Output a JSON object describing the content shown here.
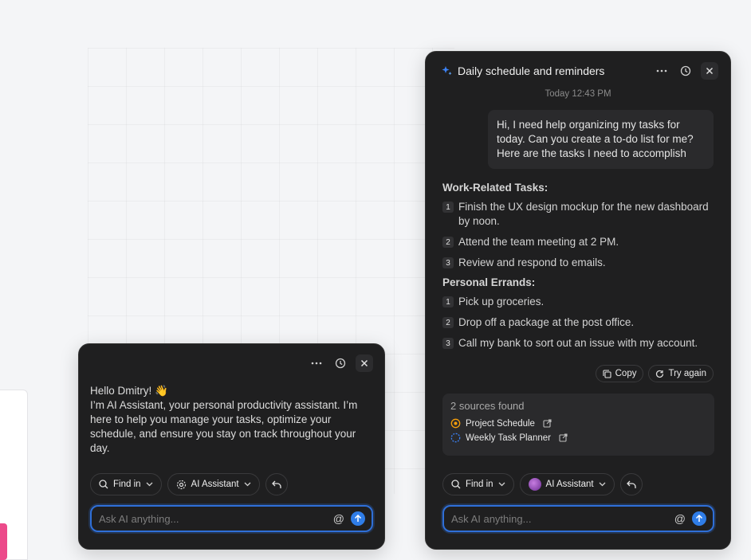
{
  "small_panel": {
    "greeting_line1": "Hello Dmitry! 👋",
    "greeting_body": "I’m AI Assistant, your personal productivity assistant. I’m here to help you manage your tasks, optimize your schedule, and ensure you stay on track throughout your day.",
    "find_in_label": "Find in",
    "assistant_label": "AI Assistant",
    "ask_placeholder": "Ask AI anything..."
  },
  "large_panel": {
    "title": "Daily schedule and reminders",
    "timestamp": "Today 12:43 PM",
    "user_message": "Hi, I need help organizing my tasks for today. Can you create a to-do list for me? Here are the tasks I need to accomplish",
    "work_title": "Work-Related Tasks:",
    "work_tasks": [
      {
        "num": "1",
        "text": "Finish the UX design mockup for the new dashboard by noon."
      },
      {
        "num": "2",
        "text": "Attend the team meeting at 2 PM."
      },
      {
        "num": "3",
        "text": "Review and respond to emails."
      }
    ],
    "personal_title": "Personal Errands:",
    "personal_tasks": [
      {
        "num": "1",
        "text": "Pick up groceries."
      },
      {
        "num": "2",
        "text": "Drop off a package at the post office."
      },
      {
        "num": "3",
        "text": "Call my bank to sort out an issue with my account."
      }
    ],
    "copy_label": "Copy",
    "try_again_label": "Try again",
    "sources_title": "2 sources found",
    "sources": [
      {
        "label": "Project Schedule",
        "icon": "project-icon"
      },
      {
        "label": "Weekly Task Planner",
        "icon": "planner-icon"
      }
    ],
    "find_in_label": "Find in",
    "assistant_label": "AI Assistant",
    "ask_placeholder": "Ask AI anything..."
  },
  "colors": {
    "panel_bg": "#1f1f20",
    "accent": "#2f7de8",
    "page_bg": "#f4f5f7",
    "pink": "#ec4a8a"
  }
}
